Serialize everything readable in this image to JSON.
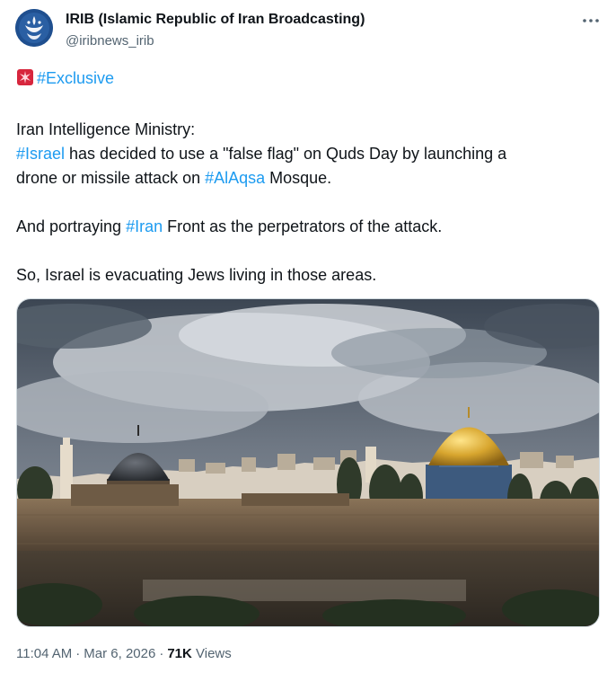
{
  "author": {
    "name": "IRIB (Islamic Republic of Iran Broadcasting)",
    "handle": "@iribnews_irib",
    "verified": false
  },
  "more_icon": "ellipsis-icon",
  "tweet": {
    "siren_icon": "rotating-light-icon",
    "header_hashtag": "#Exclusive",
    "l2": "Iran Intelligence Ministry:",
    "l3_tag": "#Israel",
    "l3_text": " has decided to use a \"false flag\" on Quds Day by launching a",
    "l4_text1": "drone or missile attack on ",
    "l4_tag": "#AlAqsa",
    "l4_text2": " Mosque.",
    "l5_text1": "And portraying ",
    "l5_tag": "#Iran",
    "l5_text2": " Front as the perpetrators of the attack.",
    "l6": "So, Israel is evacuating Jews living in those areas."
  },
  "media": {
    "subject": "Jerusalem Old City skyline with Al-Aqsa Mosque and Dome of the Rock"
  },
  "meta": {
    "time": "11:04 AM",
    "separator": "·",
    "date": "Mar 6, 2026",
    "views_count": "71K",
    "views_label": " Views"
  },
  "colors": {
    "link": "#1d9bf0",
    "text": "#0f1419",
    "secondary": "#536471",
    "border": "#cfd9de"
  }
}
